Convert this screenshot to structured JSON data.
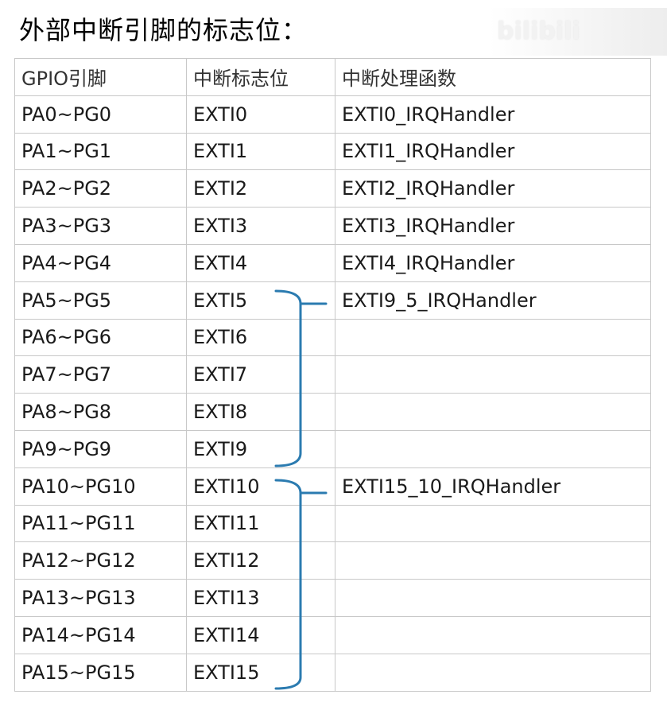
{
  "title": "外部中断引脚的标志位：",
  "watermark": "bilibili",
  "accent_color": "#2b7bb0",
  "table": {
    "headers": [
      "GPIO引脚",
      "中断标志位",
      "中断处理函数"
    ],
    "rows": [
      [
        "PA0~PG0",
        "EXTI0",
        "EXTI0_IRQHandler"
      ],
      [
        "PA1~PG1",
        "EXTI1",
        "EXTI1_IRQHandler"
      ],
      [
        "PA2~PG2",
        "EXTI2",
        "EXTI2_IRQHandler"
      ],
      [
        "PA3~PG3",
        "EXTI3",
        "EXTI3_IRQHandler"
      ],
      [
        "PA4~PG4",
        "EXTI4",
        "EXTI4_IRQHandler"
      ],
      [
        "PA5~PG5",
        "EXTI5",
        "EXTI9_5_IRQHandler"
      ],
      [
        "PA6~PG6",
        "EXTI6",
        ""
      ],
      [
        "PA7~PG7",
        "EXTI7",
        ""
      ],
      [
        "PA8~PG8",
        "EXTI8",
        ""
      ],
      [
        "PA9~PG9",
        "EXTI9",
        ""
      ],
      [
        "PA10~PG10",
        "EXTI10",
        "EXTI15_10_IRQHandler"
      ],
      [
        "PA11~PG11",
        "EXTI11",
        ""
      ],
      [
        "PA12~PG12",
        "EXTI12",
        ""
      ],
      [
        "PA13~PG13",
        "EXTI13",
        ""
      ],
      [
        "PA14~PG14",
        "EXTI14",
        ""
      ],
      [
        "PA15~PG15",
        "EXTI15",
        ""
      ]
    ]
  }
}
